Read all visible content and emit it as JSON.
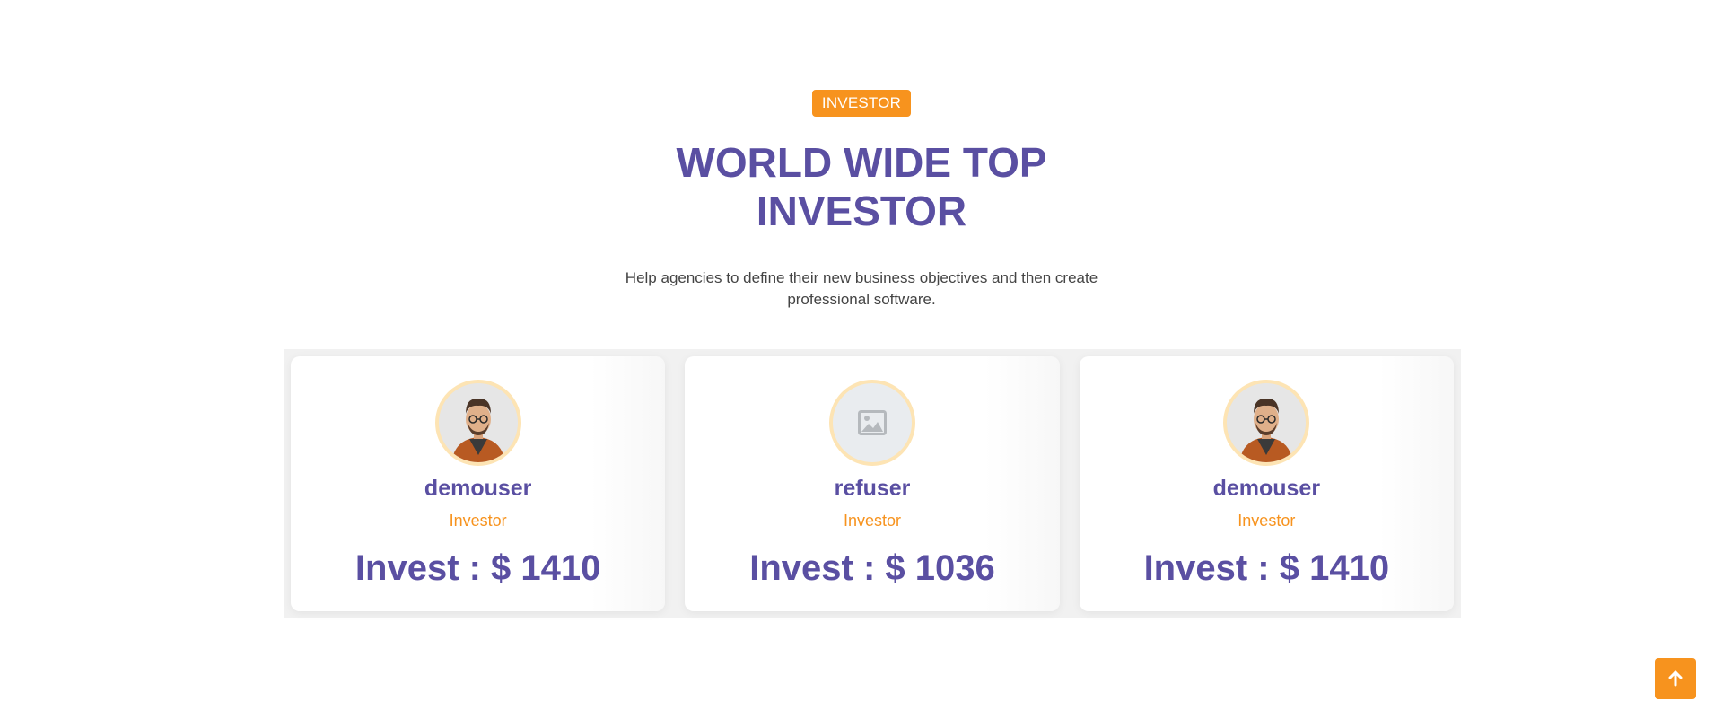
{
  "header": {
    "badge": "INVESTOR",
    "title": "WORLD WIDE TOP INVESTOR",
    "subtitle": "Help agencies to define their new business objectives and then create professional software."
  },
  "investors": [
    {
      "name": "demouser",
      "role": "Investor",
      "invest": "Invest : $ 1410",
      "avatar": "cartoon-man-avatar"
    },
    {
      "name": "refuser",
      "role": "Investor",
      "invest": "Invest : $ 1036",
      "avatar": "image-placeholder-icon"
    },
    {
      "name": "demouser",
      "role": "Investor",
      "invest": "Invest : $ 1410",
      "avatar": "cartoon-man-avatar"
    }
  ],
  "scroll_top": {
    "icon": "arrow-up-icon"
  },
  "colors": {
    "accent": "#f7931e",
    "primary": "#5a4fa2",
    "avatar_border": "#fde4b4"
  }
}
